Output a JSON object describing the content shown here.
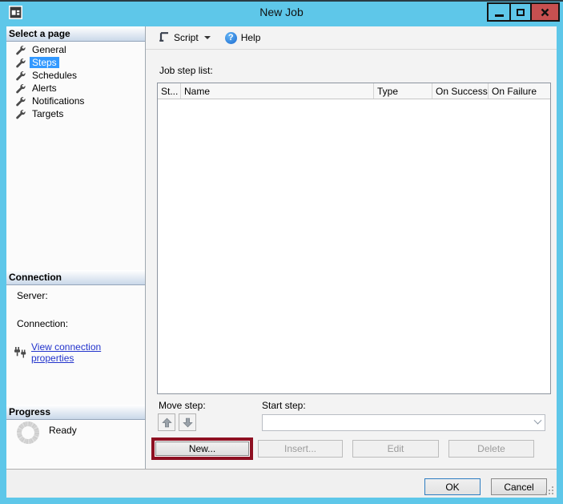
{
  "window": {
    "title": "New Job",
    "controls": {
      "minimize": "minimize",
      "maximize": "maximize",
      "close": "close"
    }
  },
  "colors": {
    "titlebar": "#5EC7E9",
    "close_button": "#C75050",
    "selection": "#3399FF",
    "annotation_border": "#8E1022",
    "link": "#2233CC"
  },
  "sidebar": {
    "pages": {
      "header": "Select a page",
      "items": [
        {
          "label": "General",
          "selected": false
        },
        {
          "label": "Steps",
          "selected": true
        },
        {
          "label": "Schedules",
          "selected": false
        },
        {
          "label": "Alerts",
          "selected": false
        },
        {
          "label": "Notifications",
          "selected": false
        },
        {
          "label": "Targets",
          "selected": false
        }
      ]
    },
    "connection": {
      "header": "Connection",
      "server_label": "Server:",
      "connection_label": "Connection:",
      "view_link": "View connection properties"
    },
    "progress": {
      "header": "Progress",
      "status": "Ready"
    }
  },
  "toolbar": {
    "script": "Script",
    "help": "Help"
  },
  "main": {
    "job_step_list_label": "Job step list:",
    "table": {
      "columns": [
        "St...",
        "Name",
        "Type",
        "On Success",
        "On Failure"
      ],
      "rows": []
    },
    "move_step_label": "Move step:",
    "start_step_label": "Start step:",
    "start_step_value": "",
    "buttons": {
      "new": "New...",
      "insert": "Insert...",
      "edit": "Edit",
      "delete": "Delete"
    }
  },
  "footer": {
    "ok": "OK",
    "cancel": "Cancel"
  }
}
